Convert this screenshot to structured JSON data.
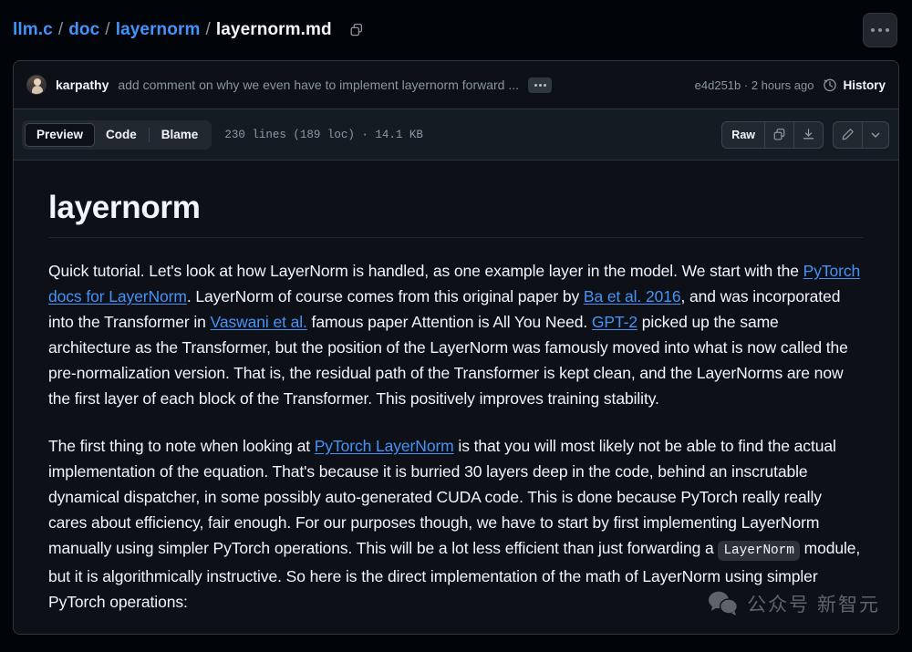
{
  "breadcrumb": {
    "root": "llm.c",
    "sep": "/",
    "path1": "doc",
    "path2": "layernorm",
    "current": "layernorm.md",
    "copy_icon": "copy-path-icon"
  },
  "header": {
    "more_options": "more-options-button"
  },
  "commit": {
    "author": "karpathy",
    "message": "add comment on why we even have to implement layernorm forward ...",
    "expand_label": "...",
    "sha": "e4d251b",
    "meta": "e4d251b · 2 hours ago",
    "history_label": "History",
    "history_icon": "clock-icon"
  },
  "toolbar": {
    "tabs": [
      {
        "label": "Preview",
        "active": true
      },
      {
        "label": "Code",
        "active": false
      },
      {
        "label": "Blame",
        "active": false
      }
    ],
    "file_meta": "230 lines (189 loc) · 14.1 KB",
    "raw_label": "Raw",
    "copy_icon": "copy-icon",
    "download_icon": "download-icon",
    "edit_icon": "pencil-icon",
    "more_icon": "chevron-down-icon"
  },
  "document": {
    "title": "layernorm",
    "paragraph1": {
      "s1": "Quick tutorial. Let's look at how LayerNorm is handled, as one example layer in the model. We start with the ",
      "link1": "PyTorch docs for LayerNorm",
      "s2": ". LayerNorm of course comes from this original paper by ",
      "link2": "Ba et al. 2016",
      "s3": ", and was incorporated into the Transformer in ",
      "link3": "Vaswani et al.",
      "s4": " famous paper Attention is All You Need. ",
      "link4": "GPT-2",
      "s5": " picked up the same architecture as the Transformer, but the position of the LayerNorm was famously moved into what is now called the pre-normalization version. That is, the residual path of the Transformer is kept clean, and the LayerNorms are now the first layer of each block of the Transformer. This positively improves training stability."
    },
    "paragraph2": {
      "s1": "The first thing to note when looking at ",
      "link1": "PyTorch LayerNorm",
      "s2": " is that you will most likely not be able to find the actual implementation of the equation. That's because it is burried 30 layers deep in the code, behind an inscrutable dynamical dispatcher, in some possibly auto-generated CUDA code. This is done because PyTorch really really cares about efficiency, fair enough. For our purposes though, we have to start by first implementing LayerNorm manually using simpler PyTorch operations. This will be a lot less efficient than just forwarding a ",
      "code1": "LayerNorm",
      "s3": " module, but it is algorithmically instructive. So here is the direct implementation of the math of LayerNorm using simpler PyTorch operations:"
    }
  },
  "watermark": {
    "icon": "wechat-icon",
    "text": "公众号  新智元"
  },
  "colors": {
    "background": "#010409",
    "panel": "#0d1117",
    "toolbar": "#151b23",
    "border": "#30363d",
    "link": "#4493f8",
    "text": "#f0f6fc",
    "muted": "#8b949e"
  }
}
